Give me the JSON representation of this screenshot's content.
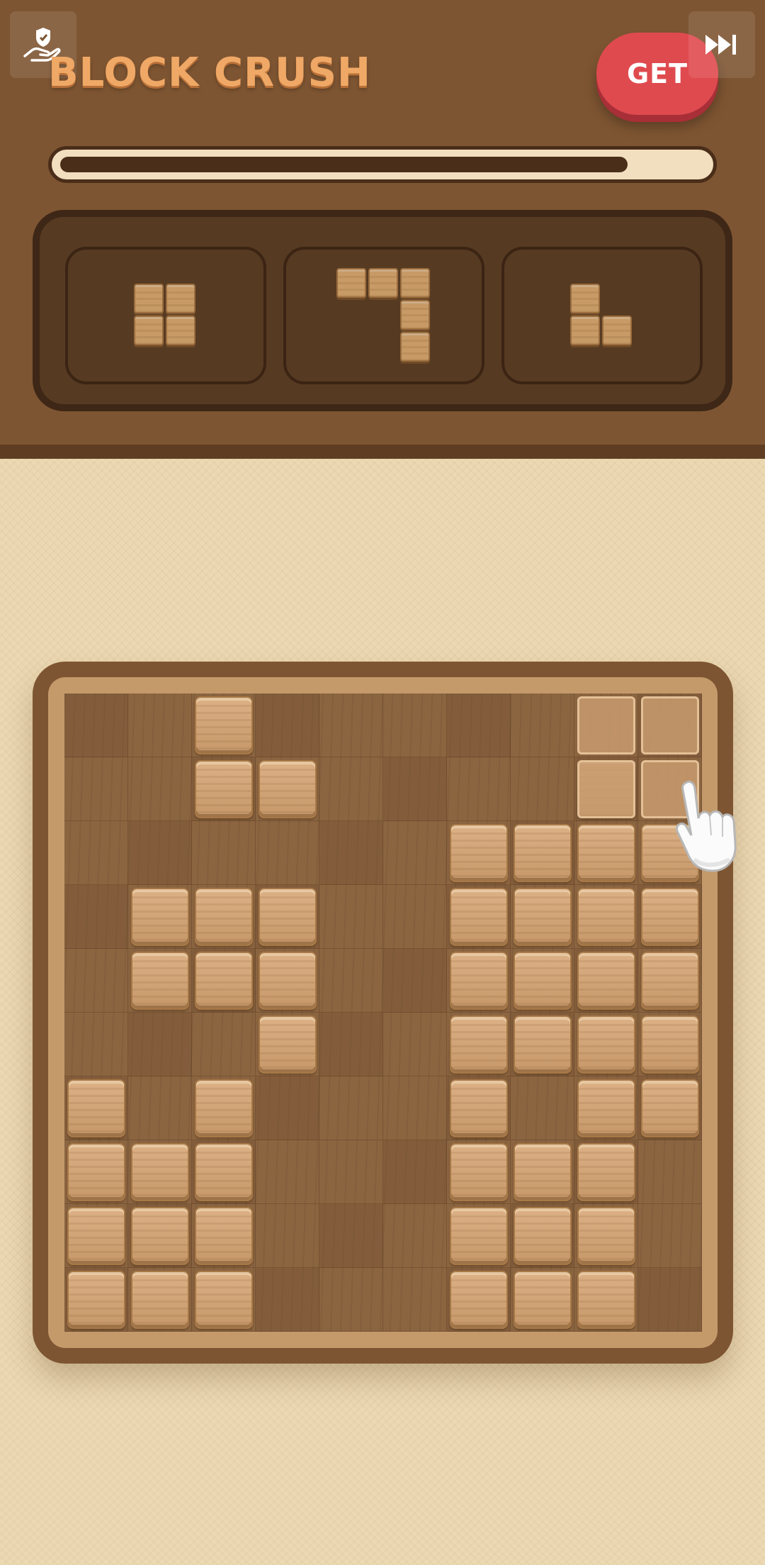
{
  "header": {
    "title": "BLOCK CRUSH",
    "get_button_label": "GET",
    "left_button_icon": "hand-shield-icon",
    "right_button_icon": "fast-forward-icon",
    "progress_fraction": 0.88
  },
  "tray": {
    "pieces": [
      {
        "name": "square-2x2",
        "cells": [
          [
            0,
            0
          ],
          [
            0,
            1
          ],
          [
            1,
            0
          ],
          [
            1,
            1
          ]
        ]
      },
      {
        "name": "hook-piece",
        "cells": [
          [
            0,
            0
          ],
          [
            0,
            1
          ],
          [
            0,
            2
          ],
          [
            1,
            2
          ],
          [
            2,
            2
          ]
        ]
      },
      {
        "name": "small-l",
        "cells": [
          [
            0,
            0
          ],
          [
            1,
            0
          ],
          [
            1,
            1
          ]
        ]
      }
    ]
  },
  "board": {
    "size": 10,
    "rows": [
      "..#.......",
      "..##....#.",
      "......####",
      ".###..####",
      ".###..####",
      "...#..####",
      "#.#...#.##",
      "###...###.",
      "###...###.",
      "###...###."
    ],
    "ghost_cells": [
      [
        0,
        8
      ],
      [
        0,
        9
      ],
      [
        1,
        8
      ],
      [
        1,
        9
      ]
    ],
    "pointer_icon": "pointing-hand-icon"
  },
  "colors": {
    "header_bg": "#7e5532",
    "title_orange": "#f0a866",
    "get_red": "#df4a4f",
    "page_bg": "#ecd9b3",
    "block_wood": "#d2a677"
  }
}
